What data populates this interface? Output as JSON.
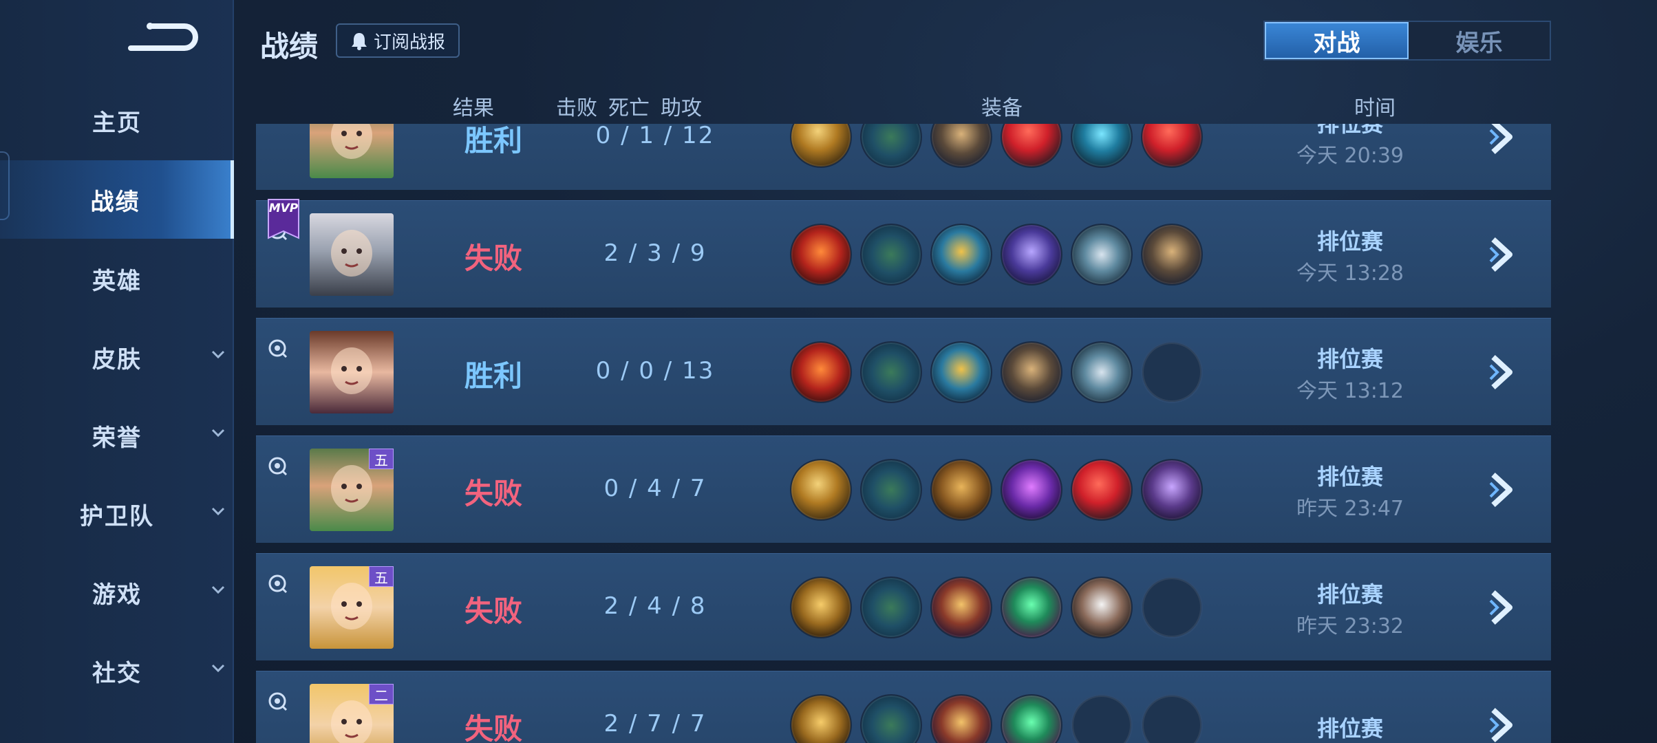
{
  "sidebar": {
    "items": [
      {
        "label": "主页",
        "has_chevron": false
      },
      {
        "label": "战绩",
        "has_chevron": false,
        "active": true
      },
      {
        "label": "英雄",
        "has_chevron": false
      },
      {
        "label": "皮肤",
        "has_chevron": true
      },
      {
        "label": "荣誉",
        "has_chevron": true
      },
      {
        "label": "护卫队",
        "has_chevron": true
      },
      {
        "label": "游戏",
        "has_chevron": true
      },
      {
        "label": "社交",
        "has_chevron": true
      }
    ]
  },
  "header": {
    "title": "战绩",
    "subscribe_label": "订阅战报",
    "tabs": [
      {
        "label": "对战",
        "active": true
      },
      {
        "label": "娱乐",
        "active": false
      }
    ]
  },
  "columns": {
    "result": "结果",
    "kills": "击败",
    "deaths": "死亡",
    "assists": "助攻",
    "equipment": "装备",
    "time": "时间"
  },
  "matches": [
    {
      "result": "胜利",
      "win": true,
      "kda": "0 / 1 / 12",
      "mode": "排位赛",
      "time": "今天 20:39",
      "mvp": false,
      "badge": "",
      "avatar": "boy-green-scarf",
      "items": [
        "gold-staff",
        "boots",
        "armor",
        "red-gem",
        "cyan-axe",
        "red-gem"
      ]
    },
    {
      "result": "失败",
      "win": false,
      "kda": "2 / 3 / 9",
      "mode": "排位赛",
      "time": "今天 13:28",
      "mvp": true,
      "mvp_label": "MVP",
      "badge": "",
      "avatar": "silver-hair-man",
      "items": [
        "red-orb",
        "boots",
        "gold-wings",
        "purple-armor",
        "silver-belt",
        "armor"
      ]
    },
    {
      "result": "胜利",
      "win": true,
      "kda": "0 / 0 / 13",
      "mode": "排位赛",
      "time": "今天 13:12",
      "mvp": false,
      "badge": "",
      "avatar": "curly-girl",
      "items": [
        "red-orb",
        "boots",
        "gold-wings",
        "armor",
        "silver-belt",
        ""
      ]
    },
    {
      "result": "失败",
      "win": false,
      "kda": "0 / 4 / 7",
      "mode": "排位赛",
      "time": "昨天 23:47",
      "mvp": false,
      "badge": "五",
      "avatar": "boy-green-scarf",
      "items": [
        "gold-staff",
        "boots",
        "gold-fist",
        "purple-scythe",
        "red-gem",
        "purple-book"
      ]
    },
    {
      "result": "失败",
      "win": false,
      "kda": "2 / 4 / 8",
      "mode": "排位赛",
      "time": "昨天 23:32",
      "mvp": false,
      "badge": "五",
      "avatar": "blonde-girl",
      "items": [
        "gold-shield",
        "boots",
        "gold-cup",
        "green-gem",
        "white-robe",
        ""
      ]
    },
    {
      "result": "失败",
      "win": false,
      "kda": "2 / 7 / 7",
      "mode": "排位赛",
      "time": "",
      "mvp": false,
      "badge": "二",
      "avatar": "blonde-girl",
      "items": [
        "gold-shield",
        "boots",
        "gold-cup",
        "green-gem",
        "",
        ""
      ]
    }
  ],
  "colors": {
    "win": "#7cc7ff",
    "lose": "#f2637e",
    "accent": "#3a86d6"
  }
}
